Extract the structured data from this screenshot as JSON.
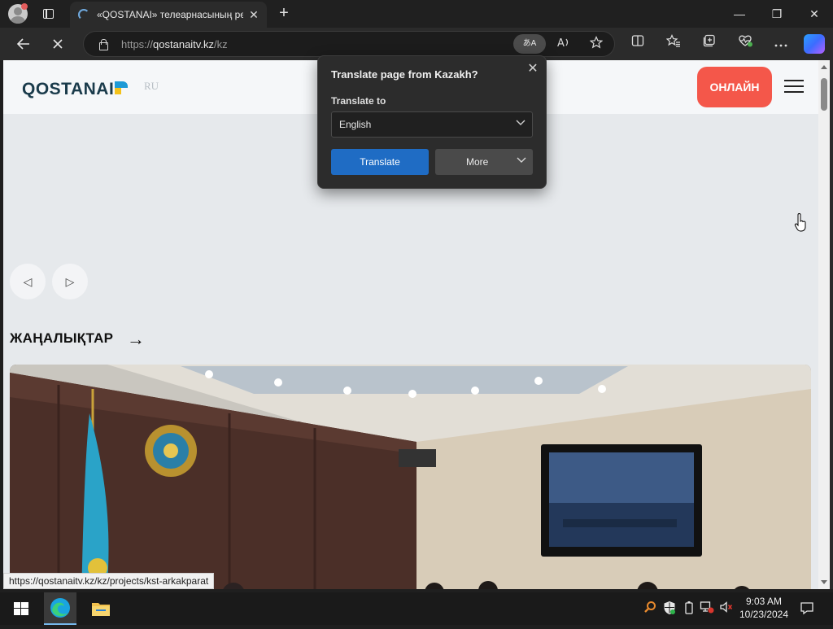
{
  "browser": {
    "tab_title": "«QOSTANAI» телеарнасының ре",
    "tab_close": "✕",
    "new_tab": "+",
    "url_prefix": "https://",
    "url_host": "qostanaitv.kz",
    "url_path": "/kz",
    "translate_pill": "あA",
    "window_min": "—",
    "window_restore": "❐",
    "window_close": "✕"
  },
  "site": {
    "logo_text": "QOSTANAI",
    "lang_link": "RU",
    "online_button": "ОНЛАЙН",
    "prev_arrow": "◁",
    "next_arrow": "▷",
    "section_title": "ЖАҢАЛЫҚТАР",
    "section_arrow": "→"
  },
  "translate_popup": {
    "title": "Translate page from Kazakh?",
    "close": "✕",
    "label": "Translate to",
    "selected_language": "English",
    "translate_button": "Translate",
    "more_button": "More"
  },
  "status_bar": {
    "hover_url": "https://qostanaitv.kz/kz/projects/kst-arkakparat"
  },
  "taskbar": {
    "time": "9:03 AM",
    "date": "10/23/2024"
  },
  "colors": {
    "online_button": "#f4574a",
    "translate_button": "#1f6cc4",
    "logo_blue": "#1e9ad6",
    "logo_yellow": "#f4c21b",
    "brand_dark": "#1a3b4b"
  }
}
